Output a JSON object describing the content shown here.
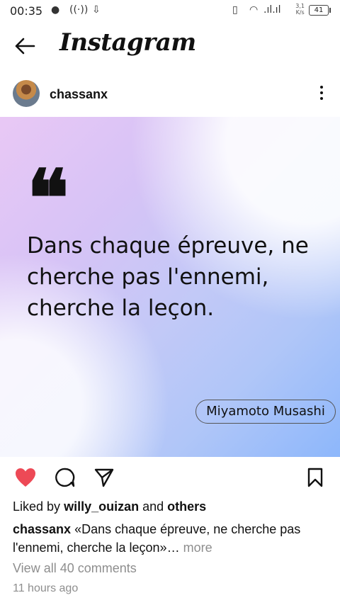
{
  "status_bar": {
    "time": "00:35",
    "net_speed_value": "3,1",
    "net_speed_unit": "K/s",
    "battery": "41"
  },
  "header": {
    "title": "Instagram"
  },
  "post": {
    "username": "chassanx",
    "image": {
      "quote": "Dans chaque épreuve, ne cherche pas l'ennemi, cherche la leçon.",
      "author": "Miyamoto Musashi"
    },
    "likes_prefix": "Liked by",
    "liked_by_user": "willy_ouizan",
    "likes_and": "and",
    "likes_others": "others",
    "caption_user": "chassanx",
    "caption_text": "«Dans chaque épreuve, ne cherche pas l'ennemi, cherche la leçon»…",
    "caption_more": "more",
    "comments_link": "View all 40 comments",
    "time_ago": "11 hours ago",
    "liked": true
  },
  "colors": {
    "like_red": "#ed4956",
    "muted_gray": "#8e8e8e"
  }
}
